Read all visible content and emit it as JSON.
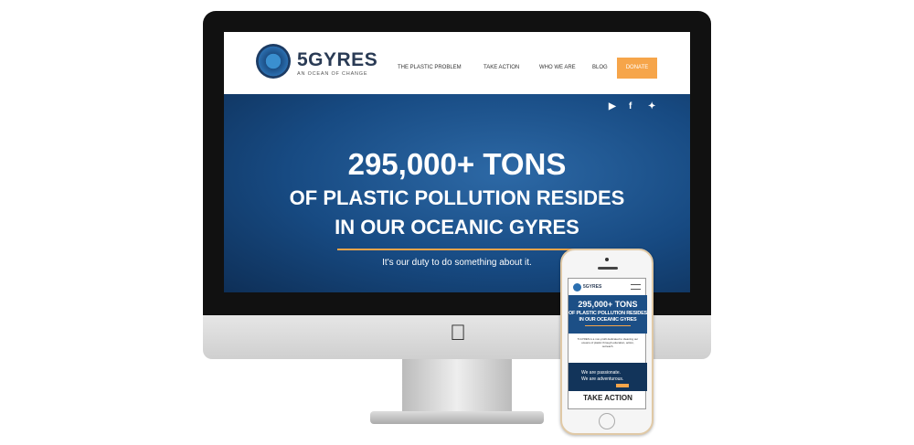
{
  "site": {
    "brand": "5GYRES",
    "tagline_logo": "AN OCEAN OF CHANGE",
    "nav": [
      "THE PLASTIC PROBLEM",
      "TAKE ACTION",
      "WHO WE ARE",
      "BLOG"
    ],
    "donate": "DONATE",
    "social": [
      "youtube-icon",
      "facebook-icon",
      "twitter-icon"
    ],
    "hero": {
      "line1": "295,000+ TONS",
      "line2": "OF PLASTIC POLLUTION RESIDES",
      "line3": "IN OUR OCEANIC GYRES",
      "subtitle": "It's our duty to do something about it."
    },
    "accent": "#f6a54a",
    "primary": "#1c4f86"
  },
  "mobile": {
    "brand": "5GYRES",
    "line1": "295,000+ TONS",
    "line2": "OF PLASTIC POLLUTION RESIDES",
    "line3": "IN OUR OCEANIC GYRES",
    "about": "5 GYRES is a non-profit dedicated to cleaning our oceans of plastic through education, action, outreach.",
    "passion1": "We are passionate.",
    "passion2": "We are adventurous.",
    "take_action": "TAKE ACTION"
  }
}
